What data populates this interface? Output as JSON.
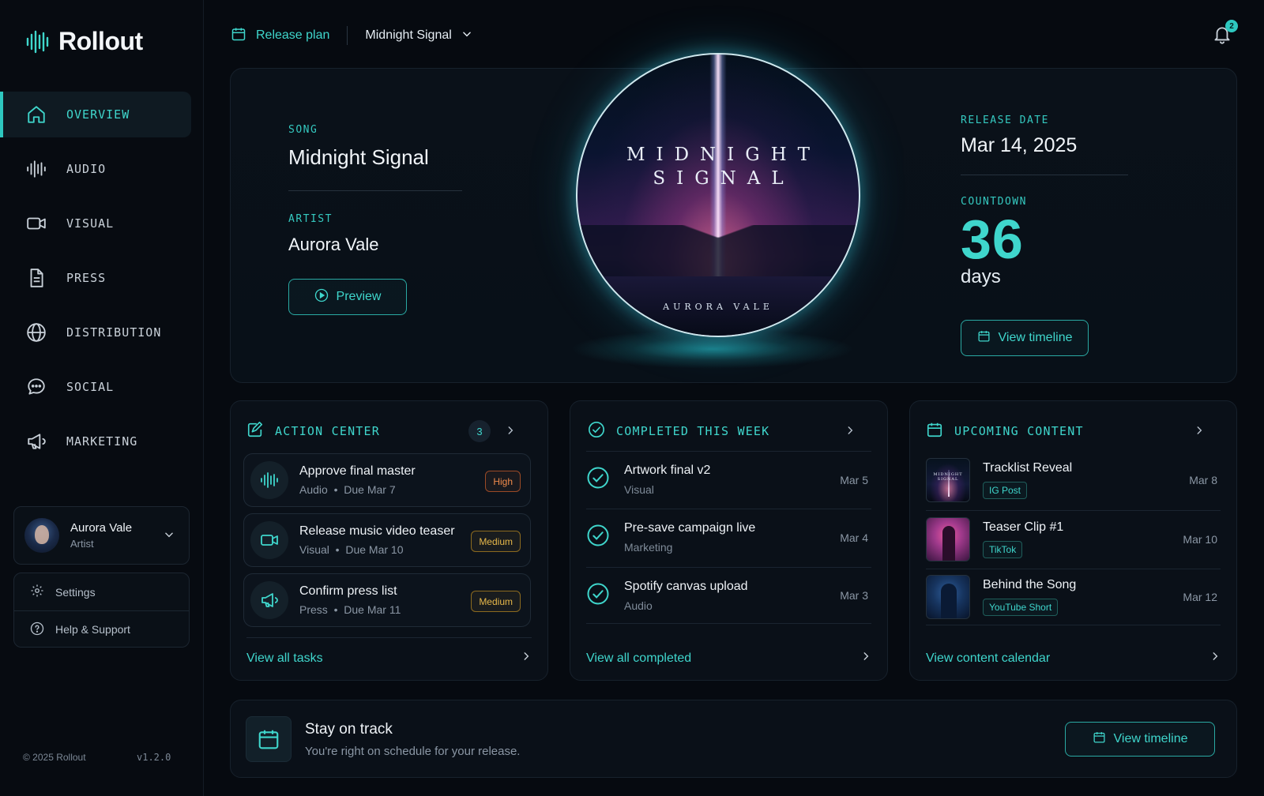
{
  "app": {
    "name": "Rollout",
    "copyright": "© 2025 Rollout",
    "version": "v1.2.0"
  },
  "sidebar": {
    "items": [
      {
        "label": "OVERVIEW",
        "icon": "home-icon",
        "active": true
      },
      {
        "label": "AUDIO",
        "icon": "waveform-icon"
      },
      {
        "label": "VISUAL",
        "icon": "video-camera-icon"
      },
      {
        "label": "PRESS",
        "icon": "document-icon"
      },
      {
        "label": "DISTRIBUTION",
        "icon": "globe-icon"
      },
      {
        "label": "SOCIAL",
        "icon": "chat-bubble-icon"
      },
      {
        "label": "MARKETING",
        "icon": "megaphone-icon"
      }
    ],
    "user": {
      "name": "Aurora Vale",
      "role": "Artist"
    },
    "settings_label": "Settings",
    "help_label": "Help & Support"
  },
  "topbar": {
    "release_plan_label": "Release plan",
    "selected_song": "Midnight Signal",
    "notification_count": "2"
  },
  "hero": {
    "song_label": "SONG",
    "song": "Midnight Signal",
    "artist_label": "ARTIST",
    "artist": "Aurora Vale",
    "preview_label": "Preview",
    "cover_title": "MIDNIGHT SIGNAL",
    "cover_artist": "AURORA VALE",
    "release_date_label": "RELEASE DATE",
    "release_date": "Mar 14, 2025",
    "countdown_label": "COUNTDOWN",
    "countdown_value": "36",
    "countdown_unit": "days",
    "view_timeline_label": "View timeline"
  },
  "action_center": {
    "title": "ACTION CENTER",
    "count": "3",
    "tasks": [
      {
        "title": "Approve final master",
        "category": "Audio",
        "due": "Due Mar 7",
        "priority": "High",
        "icon": "waveform-icon"
      },
      {
        "title": "Release music video teaser",
        "category": "Visual",
        "due": "Due Mar 10",
        "priority": "Medium",
        "icon": "video-camera-icon"
      },
      {
        "title": "Confirm press list",
        "category": "Press",
        "due": "Due Mar 11",
        "priority": "Medium",
        "icon": "megaphone-icon"
      }
    ],
    "footer_label": "View all tasks"
  },
  "completed": {
    "title": "COMPLETED THIS WEEK",
    "items": [
      {
        "title": "Artwork final v2",
        "category": "Visual",
        "date": "Mar 5"
      },
      {
        "title": "Pre-save campaign live",
        "category": "Marketing",
        "date": "Mar 4"
      },
      {
        "title": "Spotify canvas upload",
        "category": "Audio",
        "date": "Mar 3"
      }
    ],
    "footer_label": "View all completed"
  },
  "upcoming": {
    "title": "UPCOMING CONTENT",
    "items": [
      {
        "title": "Tracklist Reveal",
        "tag": "IG Post",
        "date": "Mar 8",
        "thumb_text": "MIDNIGHT SIGNAL"
      },
      {
        "title": "Teaser Clip #1",
        "tag": "TikTok",
        "date": "Mar 10"
      },
      {
        "title": "Behind the Song",
        "tag": "YouTube Short",
        "date": "Mar 12"
      }
    ],
    "footer_label": "View content calendar"
  },
  "banner": {
    "title": "Stay on track",
    "subtitle": "You're right on schedule for your release.",
    "button_label": "View timeline"
  },
  "colors": {
    "accent": "#3fd6cc",
    "high": "#f08a4b",
    "medium": "#e7b84a",
    "background": "#060a10"
  }
}
